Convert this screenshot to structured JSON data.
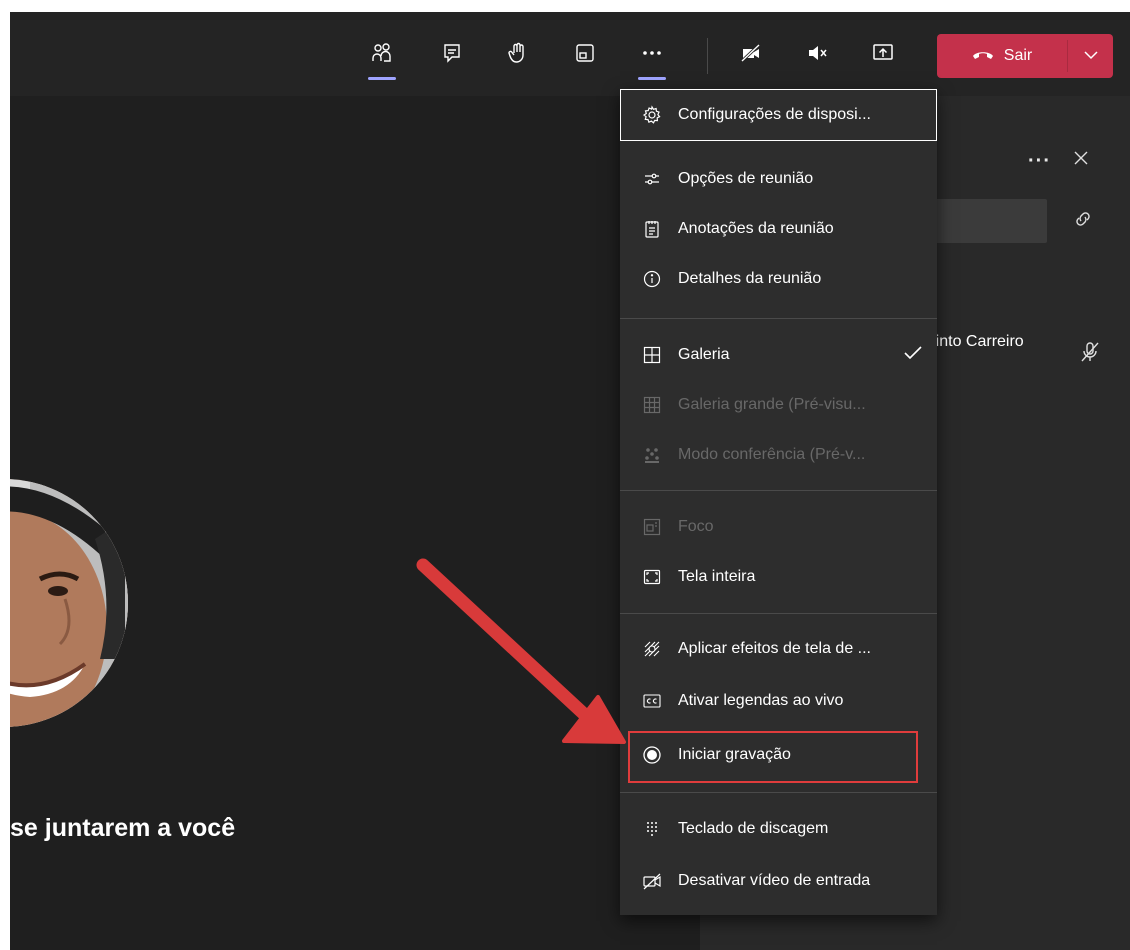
{
  "toolbar": {
    "people_icon": "people-icon",
    "chat_icon": "chat-icon",
    "raise_hand_icon": "raise-hand-icon",
    "rooms_icon": "breakout-rooms-icon",
    "more_icon": "more-actions-icon",
    "camera_icon": "camera-off-icon",
    "speaker_icon": "speaker-mute-icon",
    "share_icon": "share-tray-icon",
    "leave_label": "Sair",
    "accent_color": "#9fa4ff",
    "leave_color": "#c4314b"
  },
  "stage": {
    "status_text": "se juntarem a você"
  },
  "panel": {
    "participant_name": "Pinto Carreiro"
  },
  "menu": {
    "items": [
      {
        "label": "Configurações de disposi...",
        "icon": "gear-icon",
        "enabled": true
      },
      {
        "label": "Opções de reunião",
        "icon": "sliders-icon",
        "enabled": true
      },
      {
        "label": "Anotações da reunião",
        "icon": "notes-icon",
        "enabled": true
      },
      {
        "label": "Detalhes da reunião",
        "icon": "info-icon",
        "enabled": true
      },
      {
        "label": "Galeria",
        "icon": "grid-icon",
        "enabled": true,
        "checked": true
      },
      {
        "label": "Galeria grande (Pré-visu...",
        "icon": "large-grid-icon",
        "enabled": false
      },
      {
        "label": "Modo conferência (Pré-v...",
        "icon": "together-mode-icon",
        "enabled": false
      },
      {
        "label": "Foco",
        "icon": "focus-icon",
        "enabled": false
      },
      {
        "label": "Tela inteira",
        "icon": "fullscreen-icon",
        "enabled": true
      },
      {
        "label": "Aplicar efeitos de tela de ...",
        "icon": "background-effects-icon",
        "enabled": true
      },
      {
        "label": "Ativar legendas ao vivo",
        "icon": "captions-icon",
        "enabled": true
      },
      {
        "label": "Iniciar gravação",
        "icon": "record-icon",
        "enabled": true,
        "highlighted": true
      },
      {
        "label": "Teclado de discagem",
        "icon": "dialpad-icon",
        "enabled": true
      },
      {
        "label": "Desativar vídeo de entrada",
        "icon": "video-off-icon",
        "enabled": true
      }
    ],
    "highlight_color": "#e03c3c"
  }
}
